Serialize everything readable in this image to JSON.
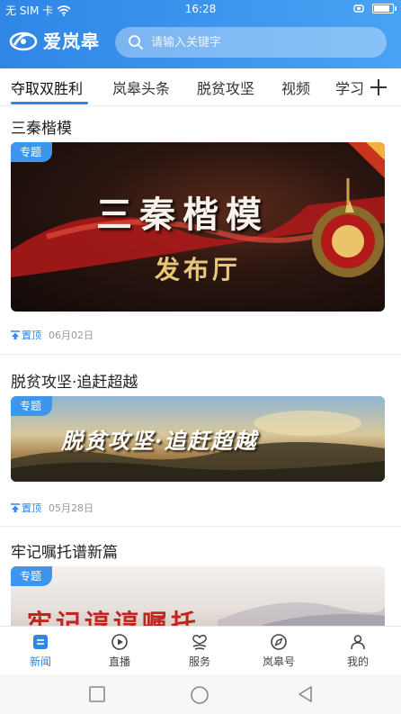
{
  "status_bar": {
    "carrier": "无 SIM 卡",
    "time": "16:28",
    "battery_level": 0.9
  },
  "header": {
    "app_name": "爱岚皋",
    "search_placeholder": "请输入关键字"
  },
  "tabs": [
    "夺取双胜利",
    "岚皋头条",
    "脱贫攻坚",
    "视频",
    "学习"
  ],
  "active_tab": 0,
  "feed": [
    {
      "title": "三秦楷模",
      "tag": "专题",
      "banner_title": "三秦楷模",
      "banner_subtitle": "发布厅",
      "pin_label": "置顶",
      "date": "06月02日"
    },
    {
      "title": "脱贫攻坚·追赶超越",
      "tag": "专题",
      "banner_title": "脱贫攻坚·追赶超越",
      "pin_label": "置顶",
      "date": "05月28日"
    },
    {
      "title": "牢记嘱托谱新篇",
      "tag": "专题",
      "banner_title": "牢记谆谆嘱托"
    }
  ],
  "bottom_nav": [
    {
      "label": "新闻",
      "icon": "news-icon",
      "active": true
    },
    {
      "label": "直播",
      "icon": "live-icon",
      "active": false
    },
    {
      "label": "服务",
      "icon": "service-icon",
      "active": false
    },
    {
      "label": "岚皋号",
      "icon": "compass-icon",
      "active": false
    },
    {
      "label": "我的",
      "icon": "user-icon",
      "active": false
    }
  ],
  "colors": {
    "accent": "#2f86e6",
    "tag": "#3e95ee"
  }
}
